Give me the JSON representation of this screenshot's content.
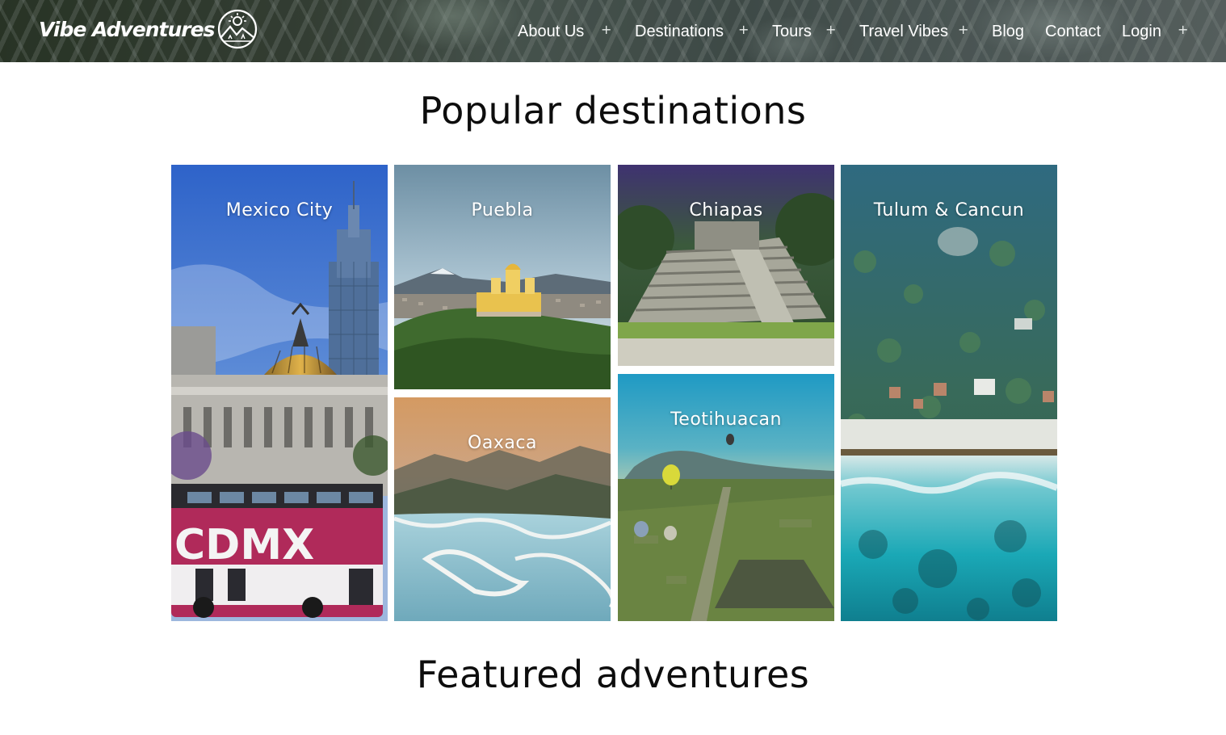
{
  "header": {
    "logo_text": "Vibe Adventures",
    "logo_icon": "sun-mountain-logo-icon",
    "nav": [
      {
        "label": "About Us",
        "has_submenu": true
      },
      {
        "label": "Destinations",
        "has_submenu": true
      },
      {
        "label": "Tours",
        "has_submenu": true
      },
      {
        "label": "Travel Vibes",
        "has_submenu": true
      },
      {
        "label": "Blog",
        "has_submenu": false
      },
      {
        "label": "Contact",
        "has_submenu": false
      },
      {
        "label": "Login",
        "has_submenu": true
      }
    ],
    "submenu_icon": "plus-icon"
  },
  "popular": {
    "title": "Popular destinations",
    "tiles": [
      {
        "label": "Mexico City"
      },
      {
        "label": "Puebla"
      },
      {
        "label": "Oaxaca"
      },
      {
        "label": "Chiapas"
      },
      {
        "label": "Teotihuacan"
      },
      {
        "label": "Tulum & Cancun"
      }
    ],
    "mexico_city_bus_text": "CDMX"
  },
  "featured": {
    "title": "Featured adventures"
  },
  "colors": {
    "text_dark": "#0d0d0d",
    "nav_text": "#ffffff",
    "background": "#ffffff"
  }
}
